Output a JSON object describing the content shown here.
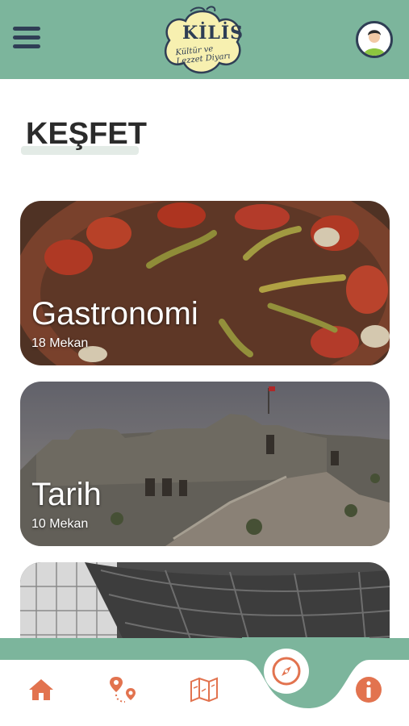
{
  "header": {
    "logo_line1": "KİLİS",
    "logo_line2": "Kültür ve Lezzet Diyarı",
    "menu_icon": "hamburger-menu-icon",
    "avatar_icon": "user-avatar-icon"
  },
  "page": {
    "title": "KEŞFET"
  },
  "categories": [
    {
      "title": "Gastronomi",
      "count": "18 Mekan"
    },
    {
      "title": "Tarih",
      "count": "10 Mekan"
    },
    {
      "title": "",
      "count": ""
    }
  ],
  "bottom_nav": {
    "items": [
      "home-icon",
      "route-pin-icon",
      "map-icon",
      "compass-icon",
      "info-icon"
    ],
    "active": "compass-icon"
  },
  "colors": {
    "header_green": "#7cb59c",
    "dark_navy": "#2f3e55",
    "accent_orange": "#e2734f"
  }
}
